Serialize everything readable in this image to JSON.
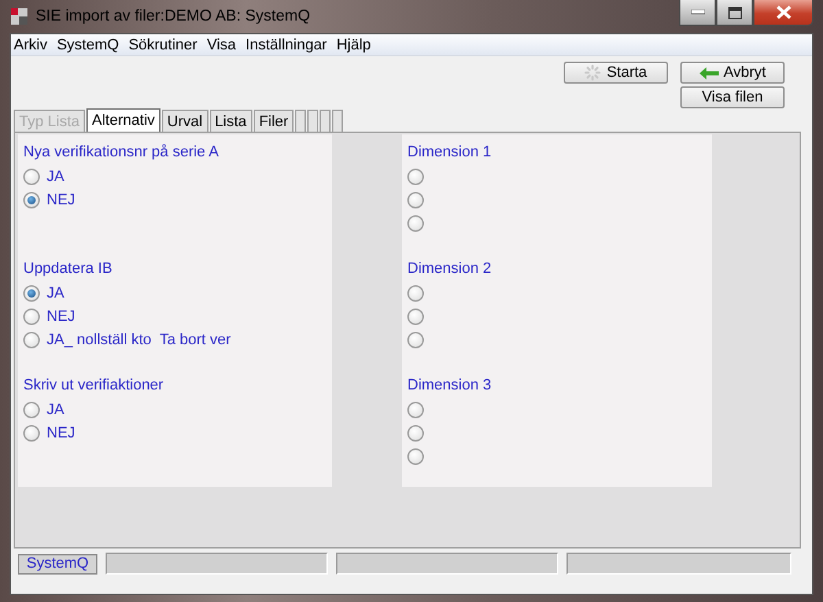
{
  "window": {
    "title": "SIE import av filer:DEMO AB: SystemQ"
  },
  "menu": [
    "Arkiv",
    "SystemQ",
    "Sökrutiner",
    "Visa",
    "Inställningar",
    "Hjälp"
  ],
  "toolbar": {
    "buttons": [
      {
        "label": "Starta",
        "kind": "gear"
      },
      {
        "label": "Avbryt",
        "kind": "back"
      },
      {
        "label": "Visa filen",
        "kind": "plain"
      }
    ]
  },
  "tabs": [
    {
      "label": "Typ Lista",
      "selected": false,
      "disabled": true
    },
    {
      "label": "Alternativ",
      "selected": true,
      "disabled": false
    },
    {
      "label": "Urval",
      "selected": false,
      "disabled": false
    },
    {
      "label": "Lista",
      "selected": false,
      "disabled": false
    },
    {
      "label": "Filer",
      "selected": false,
      "disabled": false
    },
    {
      "selected": false
    },
    {
      "selected": false
    },
    {
      "selected": false
    },
    {
      "selected": false
    }
  ],
  "left_groups": [
    {
      "title": "Nya verifikationsnr på serie A",
      "options": [
        {
          "label": "JA",
          "selected": false
        },
        {
          "label": "NEJ",
          "selected": true
        }
      ]
    },
    {
      "title": "Uppdatera IB",
      "options": [
        {
          "label": "JA",
          "selected": true
        },
        {
          "label": "NEJ",
          "selected": false
        },
        {
          "label": "JA_ nollställ kto  Ta bort ver",
          "selected": false
        }
      ]
    },
    {
      "title": "Skriv ut verifiaktioner",
      "options": [
        {
          "label": "JA",
          "selected": false
        },
        {
          "label": "NEJ",
          "selected": false
        }
      ]
    }
  ],
  "right_groups": [
    {
      "title": "Dimension 1",
      "options": [
        {
          "selected": false
        },
        {
          "selected": false
        },
        {
          "selected": false
        }
      ]
    },
    {
      "title": "Dimension 2",
      "options": [
        {
          "selected": false
        },
        {
          "selected": false
        },
        {
          "selected": false
        }
      ]
    },
    {
      "title": "Dimension 3",
      "options": [
        {
          "selected": false
        },
        {
          "selected": false
        },
        {
          "selected": false
        }
      ]
    }
  ],
  "status_bar": {
    "button": "SystemQ"
  }
}
